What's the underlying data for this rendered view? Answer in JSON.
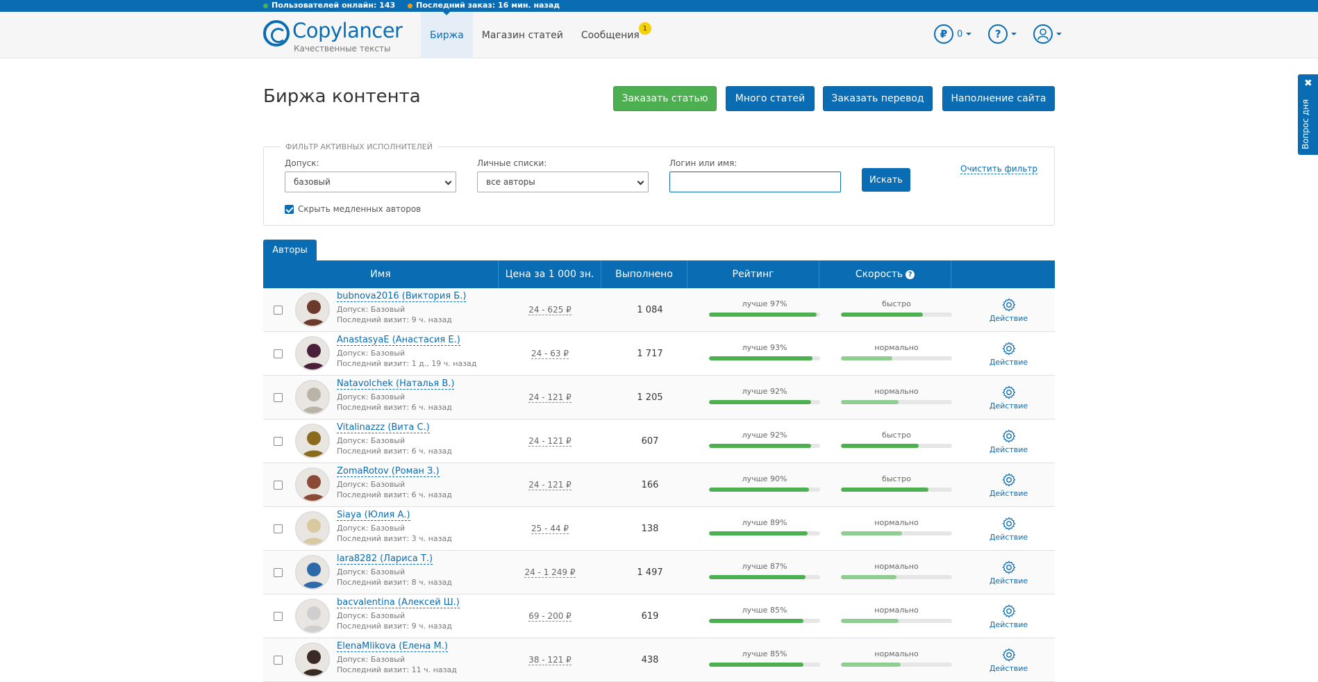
{
  "topbar": {
    "online": "Пользователей онлайн: 143",
    "last_order": "Последний заказ: 16 мин. назад",
    "online_color": "#4caf50",
    "order_color": "#f39c12"
  },
  "header": {
    "logo_text": "Copylancer",
    "logo_sub": "Качественные тексты",
    "nav": [
      {
        "label": "Биржа",
        "active": true
      },
      {
        "label": "Магазин статей",
        "active": false
      },
      {
        "label": "Сообщения",
        "active": false,
        "badge": "1"
      }
    ],
    "balance": "0",
    "icons": [
      "ruble-icon",
      "help-icon",
      "user-icon"
    ]
  },
  "page": {
    "title": "Биржа контента",
    "buttons": {
      "order_article": "Заказать статью",
      "many_articles": "Много статей",
      "order_translation": "Заказать перевод",
      "site_content": "Наполнение сайта"
    }
  },
  "filter": {
    "legend": "ФИЛЬТР АКТИВНЫХ ИСПОЛНИТЕЛЕЙ",
    "access_label": "Допуск:",
    "access_value": "базовый",
    "lists_label": "Личные списки:",
    "lists_value": "все авторы",
    "login_label": "Логин или имя:",
    "login_value": "",
    "search_button": "Искать",
    "clear_link": "Очистить фильтр",
    "hide_slow_label": "Скрыть медленных авторов",
    "hide_slow_checked": true
  },
  "tabs": {
    "authors": "Авторы"
  },
  "table": {
    "headers": {
      "name": "Имя",
      "price": "Цена за 1 000 зн.",
      "done": "Выполнено",
      "rating": "Рейтинг",
      "speed": "Скорость",
      "speed_help": "?"
    },
    "action_label": "Действие",
    "rows": [
      {
        "name": "bubnova2016 (Виктория Б.)",
        "access": "Допуск: Базовый",
        "visit": "Последний визит: 9 ч. назад",
        "price": "24 - 625 ₽",
        "done": "1 084",
        "rating_label": "лучше 97%",
        "rating": 0.97,
        "speed_label": "быстро",
        "speed": 0.74,
        "avatar_color": "#6b3a2a"
      },
      {
        "name": "AnastasyaE (Анастасия Е.)",
        "access": "Допуск: Базовый",
        "visit": "Последний визит: 1 д., 19 ч. назад",
        "price": "24 - 63 ₽",
        "done": "1 717",
        "rating_label": "лучше 93%",
        "rating": 0.93,
        "speed_label": "нормально",
        "speed": 0.46,
        "avatar_color": "#4a1f3a"
      },
      {
        "name": "Natavolchek (Наталья В.)",
        "access": "Допуск: Базовый",
        "visit": "Последний визит: 6 ч. назад",
        "price": "24 - 121 ₽",
        "done": "1 205",
        "rating_label": "лучше 92%",
        "rating": 0.92,
        "speed_label": "нормально",
        "speed": 0.52,
        "avatar_color": "#b9b3a8"
      },
      {
        "name": "Vitalinazzz (Вита С.)",
        "access": "Допуск: Базовый",
        "visit": "Последний визит: 6 ч. назад",
        "price": "24 - 121 ₽",
        "done": "607",
        "rating_label": "лучше 92%",
        "rating": 0.92,
        "speed_label": "быстро",
        "speed": 0.7,
        "avatar_color": "#8a6a1c"
      },
      {
        "name": "ZomaRotov (Роман З.)",
        "access": "Допуск: Базовый",
        "visit": "Последний визит: 6 ч. назад",
        "price": "24 - 121 ₽",
        "done": "166",
        "rating_label": "лучше 90%",
        "rating": 0.9,
        "speed_label": "быстро",
        "speed": 0.79,
        "avatar_color": "#8a4a36"
      },
      {
        "name": "Siaya (Юлия А.)",
        "access": "Допуск: Базовый",
        "visit": "Последний визит: 3 ч. назад",
        "price": "25 - 44 ₽",
        "done": "138",
        "rating_label": "лучше 89%",
        "rating": 0.89,
        "speed_label": "нормально",
        "speed": 0.55,
        "avatar_color": "#d8c9a0"
      },
      {
        "name": "lara8282 (Лариса Т.)",
        "access": "Допуск: Базовый",
        "visit": "Последний визит: 8 ч. назад",
        "price": "24 - 1 249 ₽",
        "done": "1 497",
        "rating_label": "лучше 87%",
        "rating": 0.87,
        "speed_label": "нормально",
        "speed": 0.5,
        "avatar_color": "#2f6aa8"
      },
      {
        "name": "bacvalentina (Алексей Ш.)",
        "access": "Допуск: Базовый",
        "visit": "Последний визит: 9 ч. назад",
        "price": "69 - 200 ₽",
        "done": "619",
        "rating_label": "лучше 85%",
        "rating": 0.85,
        "speed_label": "нормально",
        "speed": 0.52,
        "avatar_color": "#cfcfcf"
      },
      {
        "name": "ElenaMlikova (Елена М.)",
        "access": "Допуск: Базовый",
        "visit": "Последний визит: 11 ч. назад",
        "price": "38 - 121 ₽",
        "done": "438",
        "rating_label": "лучше 85%",
        "rating": 0.85,
        "speed_label": "нормально",
        "speed": 0.54,
        "avatar_color": "#3a2a24"
      }
    ]
  },
  "side_tab": {
    "label": "Вопрос дня",
    "close": "✖"
  }
}
